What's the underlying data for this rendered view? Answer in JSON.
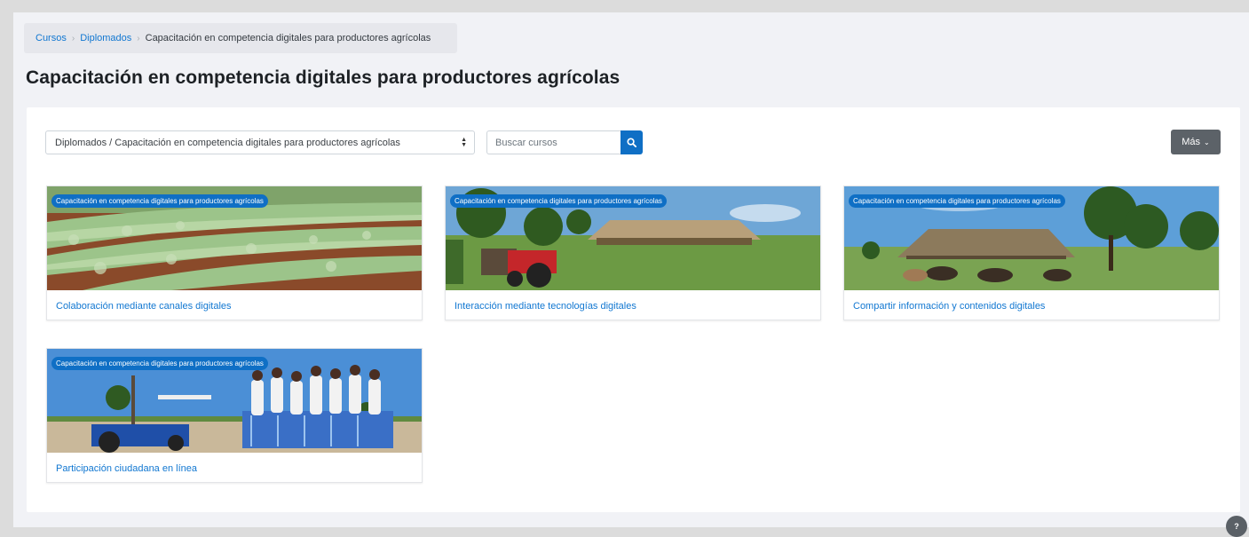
{
  "breadcrumb": {
    "items": [
      "Cursos",
      "Diplomados"
    ],
    "current": "Capacitación en competencia digitales para productores agrícolas",
    "separator": "›"
  },
  "page_title": "Capacitación en competencia digitales para productores agrícolas",
  "filters": {
    "category_value": "Diplomados / Capacitación en competencia digitales para productores agrícolas",
    "search_placeholder": "Buscar cursos",
    "more_label": "Más"
  },
  "courses": [
    {
      "category_badge": "Capacitación en competencia digitales para productores agrícolas",
      "name": "Colaboración mediante canales digitales",
      "image": "cabbage-field"
    },
    {
      "category_badge": "Capacitación en competencia digitales para productores agrícolas",
      "name": "Interacción mediante tecnologías digitales",
      "image": "tractor-shed"
    },
    {
      "category_badge": "Capacitación en competencia digitales para productores agrícolas",
      "name": "Compartir información y contenidos digitales",
      "image": "cattle-shelter"
    },
    {
      "category_badge": "Capacitación en competencia digitales para productores agrícolas",
      "name": "Participación ciudadana en línea",
      "image": "tractor-group"
    }
  ],
  "help_label": "?",
  "colors": {
    "accent": "#0f6fc5",
    "link": "#1177d1",
    "secondary_button": "#5c6268"
  }
}
